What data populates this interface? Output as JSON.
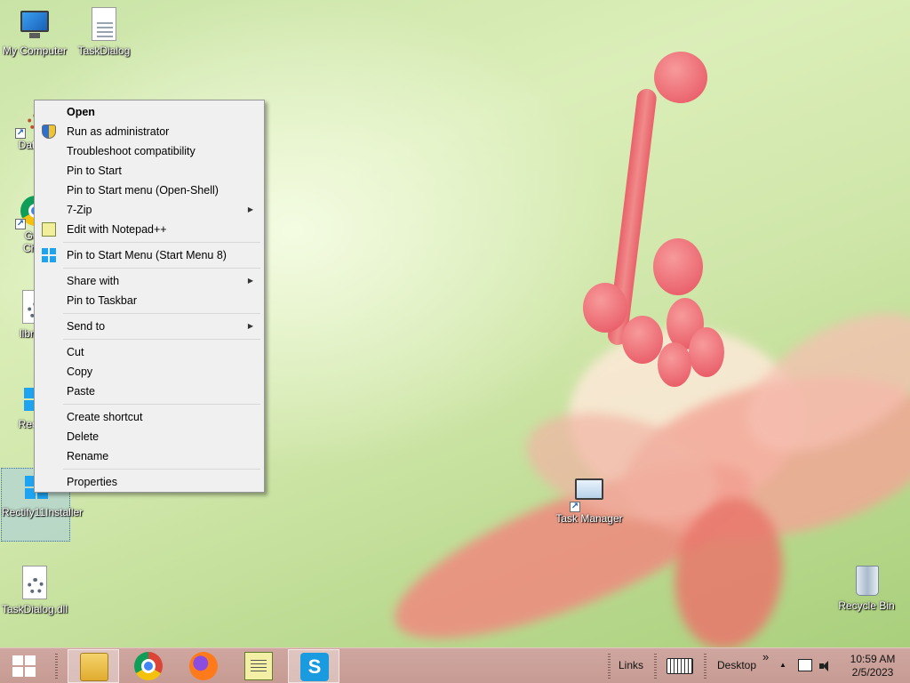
{
  "desktop": {
    "icons": {
      "my_computer": "My Computer",
      "taskdialog": "TaskDialog",
      "datawhatever": "DataW",
      "chrome_line1": "Goo",
      "chrome_line2": "Chro",
      "libmss": "libmss",
      "rectify": "Rectify",
      "rectify_installer": "Rectify11Installer",
      "task_manager": "Task Manager",
      "taskdialog_dll": "TaskDialog.dll",
      "recycle_bin": "Recycle Bin"
    }
  },
  "context_menu": {
    "open": "Open",
    "run_as_admin": "Run as administrator",
    "troubleshoot": "Troubleshoot compatibility",
    "pin_to_start": "Pin to Start",
    "pin_to_start_openshell": "Pin to Start menu (Open-Shell)",
    "seven_zip": "7-Zip",
    "edit_notepadpp": "Edit with Notepad++",
    "pin_start8": "Pin to Start Menu (Start Menu 8)",
    "share_with": "Share with",
    "pin_taskbar": "Pin to Taskbar",
    "send_to": "Send to",
    "cut": "Cut",
    "copy": "Copy",
    "paste": "Paste",
    "create_shortcut": "Create shortcut",
    "delete": "Delete",
    "rename": "Rename",
    "properties": "Properties",
    "submenu_arrow": "▶"
  },
  "taskbar": {
    "links": "Links",
    "desktop": "Desktop",
    "chevron": "»",
    "up_arrow": "▲",
    "time": "10:59 AM",
    "date": "2/5/2023",
    "skype_glyph": "S"
  },
  "colors": {
    "taskbar": "#c69b93",
    "menu_bg": "#f0f0f0",
    "accent": "#1ea3f0"
  }
}
